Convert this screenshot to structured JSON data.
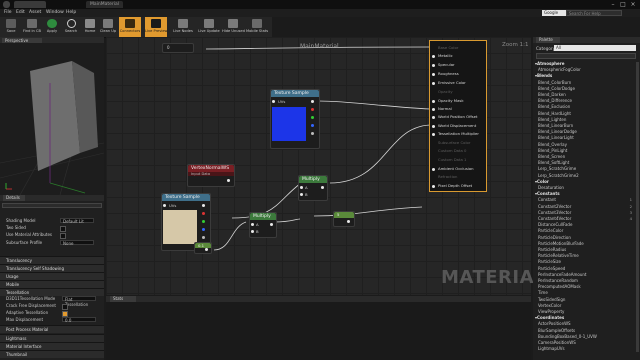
{
  "window": {
    "tabs": [
      "MainMaterial"
    ],
    "controls": [
      "minimize",
      "maximize",
      "close"
    ]
  },
  "menu": [
    "File",
    "Edit",
    "Asset",
    "Window",
    "Help"
  ],
  "search_button": "Google",
  "search_placeholder": "Search For Help",
  "toolbar": [
    {
      "label": "Save",
      "icon": "save-icon",
      "active": false
    },
    {
      "label": "Find in CB",
      "icon": "find-in-cb-icon",
      "active": false
    },
    {
      "label": "Apply",
      "icon": "apply-icon",
      "active": false
    },
    {
      "label": "Search",
      "icon": "search-icon",
      "active": false
    },
    {
      "label": "Home",
      "icon": "home-icon",
      "active": false
    },
    {
      "label": "Clean Up",
      "icon": "clean-up-icon",
      "active": false
    },
    {
      "label": "Connectors",
      "icon": "connectors-icon",
      "active": true
    },
    {
      "label": "Live Preview",
      "icon": "live-preview-icon",
      "active": true
    },
    {
      "label": "Live Nodes",
      "icon": "live-nodes-icon",
      "active": false
    },
    {
      "label": "Live Update",
      "icon": "live-update-icon",
      "active": false
    },
    {
      "label": "Hide Unused",
      "icon": "hide-unused-icon",
      "active": false
    },
    {
      "label": "Mobile Stats",
      "icon": "mobile-stats-icon",
      "active": false
    }
  ],
  "viewport": {
    "tab": "Perspective"
  },
  "details": {
    "tab": "Details",
    "rows": [
      {
        "label": "Shading Model",
        "value": "Default Lit",
        "type": "dropdown"
      },
      {
        "label": "Two Sided",
        "type": "checkbox"
      },
      {
        "label": "Use Material Attributes",
        "type": "checkbox"
      },
      {
        "label": "Subsurface Profile",
        "value": "None",
        "type": "dropdown"
      }
    ],
    "sections": [
      "Translucency",
      "Translucency Self Shadowing",
      "Usage",
      "Mobile",
      "Tessellation"
    ],
    "tessellation_rows": [
      {
        "label": "D3D11Tessellation Mode",
        "value": "Flat Tessellation",
        "type": "dropdown"
      },
      {
        "label": "Crack Free Displacement",
        "type": "checkbox"
      },
      {
        "label": "Adaptive Tessellation",
        "type": "checkbox"
      },
      {
        "label": "Max Displacement",
        "value": "0.0",
        "type": "number"
      }
    ],
    "bottom_sections": [
      "Post Process Material",
      "Lightmass",
      "Material Interface",
      "Thumbnail"
    ]
  },
  "graph": {
    "title": "MainMaterial",
    "zoom": "Zoom 1:1",
    "watermark": "MATERIAL",
    "nodes": {
      "top_stub": "0",
      "texture_sample_1": {
        "title": "Texture Sample",
        "pin": "UVs"
      },
      "vertex_normal": {
        "title": "VertexNormalWS",
        "subtitle": "Input Data"
      },
      "texture_sample_2": {
        "title": "Texture Sample",
        "pin": "UVs"
      },
      "multiply_1": {
        "title": "Multiply",
        "pins": [
          "A",
          "B"
        ]
      },
      "multiply_2": {
        "title": "Multiply",
        "pins": [
          "A",
          "B"
        ]
      },
      "constant_1": "0.1",
      "constant_2": "5"
    },
    "main_inputs": [
      {
        "label": "Base Color",
        "dim": true
      },
      {
        "label": "Metallic",
        "dim": false
      },
      {
        "label": "Specular",
        "dim": false
      },
      {
        "label": "Roughness",
        "dim": false
      },
      {
        "label": "Emissive Color",
        "dim": false
      },
      {
        "label": "Opacity",
        "dim": true
      },
      {
        "label": "Opacity Mask",
        "dim": false
      },
      {
        "label": "Normal",
        "dim": false
      },
      {
        "label": "World Position Offset",
        "dim": false
      },
      {
        "label": "World Displacement",
        "dim": false
      },
      {
        "label": "Tessellation Multiplier",
        "dim": false
      },
      {
        "label": "Subsurface Color",
        "dim": true
      },
      {
        "label": "Custom Data 0",
        "dim": true
      },
      {
        "label": "Custom Data 1",
        "dim": true
      },
      {
        "label": "Ambient Occlusion",
        "dim": false
      },
      {
        "label": "Refraction",
        "dim": true
      },
      {
        "label": "Pixel Depth Offset",
        "dim": false
      }
    ]
  },
  "stats": {
    "tab": "Stats"
  },
  "palette": {
    "tab": "Palette",
    "category_label": "Category",
    "category_value": "All",
    "items": [
      {
        "label": "Atmosphere",
        "cat": true
      },
      {
        "label": "AtmosphericFogColor"
      },
      {
        "label": "Blends",
        "cat": true
      },
      {
        "label": "Blend_ColorBurn"
      },
      {
        "label": "Blend_ColorDodge"
      },
      {
        "label": "Blend_Darken"
      },
      {
        "label": "Blend_Difference"
      },
      {
        "label": "Blend_Exclusion"
      },
      {
        "label": "Blend_HardLight"
      },
      {
        "label": "Blend_Lighten"
      },
      {
        "label": "Blend_LinearBurn"
      },
      {
        "label": "Blend_LinearDodge"
      },
      {
        "label": "Blend_LinearLight"
      },
      {
        "label": "Blend_Overlay"
      },
      {
        "label": "Blend_PinLight"
      },
      {
        "label": "Blend_Screen"
      },
      {
        "label": "Blend_SoftLight"
      },
      {
        "label": "Lerp_ScratchGrime"
      },
      {
        "label": "Lerp_ScratchGrime2"
      },
      {
        "label": "Color",
        "cat": true
      },
      {
        "label": "Desaturation"
      },
      {
        "label": "Constants",
        "cat": true
      },
      {
        "label": "Constant",
        "shortcut": "1"
      },
      {
        "label": "Constant2Vector",
        "shortcut": "2"
      },
      {
        "label": "Constant3Vector",
        "shortcut": "3"
      },
      {
        "label": "Constant4Vector",
        "shortcut": "4"
      },
      {
        "label": "DistanceCullFade"
      },
      {
        "label": "ParticleColor"
      },
      {
        "label": "ParticleDirection"
      },
      {
        "label": "ParticleMotionBlurFade"
      },
      {
        "label": "ParticleRadius"
      },
      {
        "label": "ParticleRelativeTime"
      },
      {
        "label": "ParticleSize"
      },
      {
        "label": "ParticleSpeed"
      },
      {
        "label": "PerInstanceFadeAmount"
      },
      {
        "label": "PerInstanceRandom"
      },
      {
        "label": "PrecomputedAOMask"
      },
      {
        "label": "Time"
      },
      {
        "label": "TwoSidedSign"
      },
      {
        "label": "VertexColor"
      },
      {
        "label": "ViewProperty"
      },
      {
        "label": "Coordinates",
        "cat": true
      },
      {
        "label": "ActorPositionWS"
      },
      {
        "label": "BlurSampleOffsets"
      },
      {
        "label": "BoundingBoxBased_0-1_UVW"
      },
      {
        "label": "CameraPositionWS"
      },
      {
        "label": "LightmapUVs"
      }
    ]
  },
  "colors": {
    "accent": "#e19a2f",
    "texture_header": "#3f6f8a",
    "vertex_header": "#7a1f24",
    "multiply_header": "#3c7a3c",
    "constant_header": "#5a8a3a",
    "main_node": "#151515"
  }
}
